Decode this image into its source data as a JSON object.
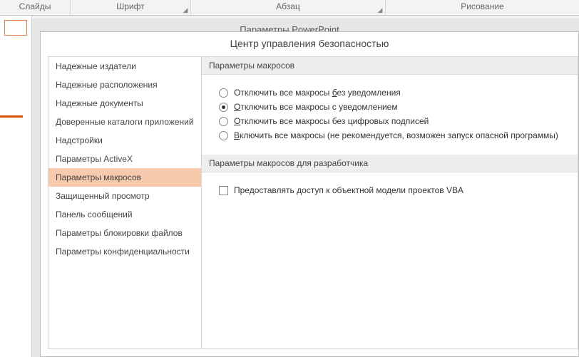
{
  "ribbon": {
    "groups": [
      "Слайды",
      "Шрифт",
      "Абзац",
      "Рисование"
    ]
  },
  "dialog_behind_title": "Параметры PowerPoint",
  "dialog": {
    "title": "Центр управления безопасностью",
    "nav": [
      "Надежные издатели",
      "Надежные расположения",
      "Надежные документы",
      "Доверенные каталоги приложений",
      "Надстройки",
      "Параметры ActiveX",
      "Параметры макросов",
      "Защищенный просмотр",
      "Панель сообщений",
      "Параметры блокировки файлов",
      "Параметры конфиденциальности"
    ],
    "nav_selected_index": 6,
    "section1_title": "Параметры макросов",
    "radios": [
      {
        "pre": "Отключить все макросы ",
        "u": "б",
        "post": "ез уведомления"
      },
      {
        "pre": "",
        "u": "О",
        "post": "тключить все макросы с уведомлением"
      },
      {
        "pre": "",
        "u": "О",
        "post": "тключить все макросы без цифровых подписей"
      },
      {
        "pre": "",
        "u": "В",
        "post": "ключить все макросы (не рекомендуется, возможен запуск опасной программы)"
      }
    ],
    "radio_selected_index": 1,
    "section2_title": "Параметры макросов для разработчика",
    "checkbox_label": "Предоставлять доступ к объектной модели проектов VBA"
  }
}
